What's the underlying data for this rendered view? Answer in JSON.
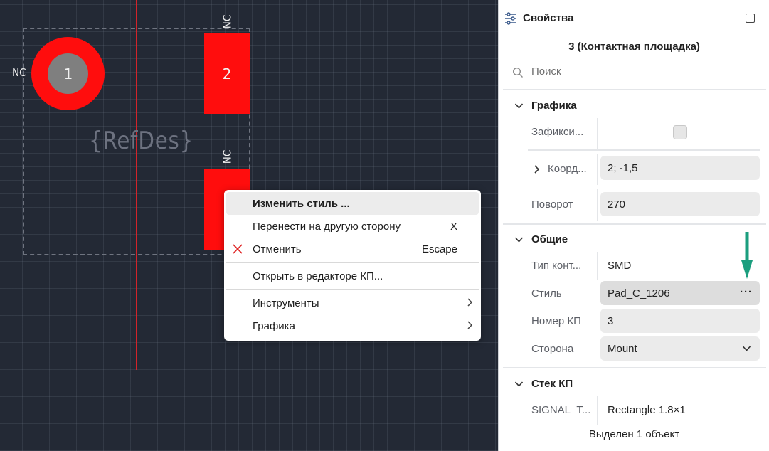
{
  "canvas": {
    "pad1_label": "1",
    "pad2_label": "2",
    "nc_left": "NC",
    "nc_top": "NC",
    "nc_mid": "NC",
    "refdes": "{RefDes}"
  },
  "context_menu": {
    "items": [
      {
        "label": "Изменить стиль ...",
        "shortcut": ""
      },
      {
        "label": "Перенести на другую сторону",
        "shortcut": "X"
      },
      {
        "label": "Отменить",
        "shortcut": "Escape",
        "icon": "close-icon"
      },
      {
        "label": "Открыть в редакторе КП...",
        "shortcut": ""
      },
      {
        "label": "Инструменты",
        "shortcut": ""
      },
      {
        "label": "Графика",
        "shortcut": ""
      }
    ]
  },
  "panel": {
    "title": "Свойства",
    "subtitle": "3 (Контактная площадка)",
    "search_placeholder": "Поиск",
    "sections": {
      "graphics": {
        "title": "Графика",
        "fixed_label": "Зафикси...",
        "coords_label": "Коорд...",
        "coords_value": "2; -1,5",
        "rotation_label": "Поворот",
        "rotation_value": "270"
      },
      "general": {
        "title": "Общие",
        "pad_type_label": "Тип конт...",
        "pad_type_value": "SMD",
        "style_label": "Стиль",
        "style_value": "Pad_C_1206",
        "style_more": "···",
        "pad_number_label": "Номер КП",
        "pad_number_value": "3",
        "side_label": "Сторона",
        "side_value": "Mount"
      },
      "stack": {
        "title": "Стек КП",
        "signal_label": "SIGNAL_T...",
        "signal_value": "Rectangle 1.8×1"
      }
    },
    "footer": "Выделен 1 объект"
  },
  "colors": {
    "canvas_bg": "#232935",
    "pad_red": "#ff0d0d",
    "crosshair": "#d3232a",
    "arrow": "#1b9e7e"
  }
}
